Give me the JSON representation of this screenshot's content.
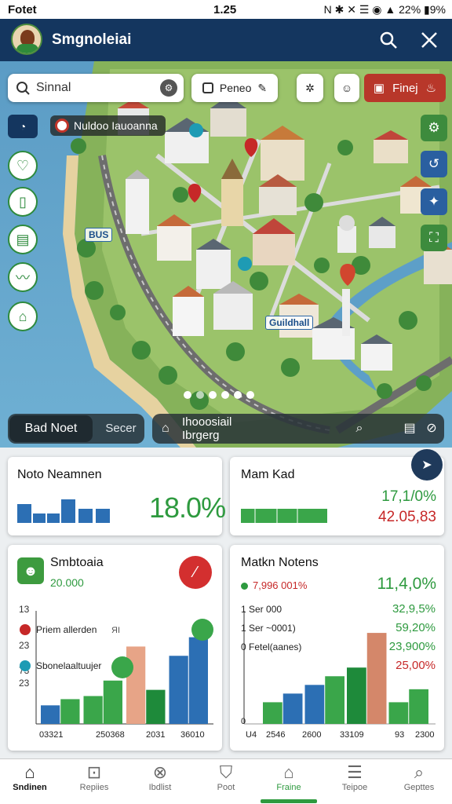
{
  "status_bar": {
    "left": "Fotet",
    "time": "1.25",
    "right": "N ✱ ✕ ☰ ◉ ▲ 22% ▮9%"
  },
  "header": {
    "title": "Smgnoleiai",
    "search_icon": "search-icon",
    "close_icon": "close-icon"
  },
  "map": {
    "search": {
      "placeholder": "Sinnal"
    },
    "filter_chip": "Peneo",
    "find_button": "Finej",
    "location_tag": "Nuldoo Iauoanna",
    "label_bus": "BUS",
    "label_building": "Guildhall",
    "carousel": {
      "count": 6,
      "active": 1
    }
  },
  "toolbar": {
    "seg_active": "Bad Noet",
    "seg_other": "Secer",
    "filter_text": "Ihooosiail Ibrgerg­"
  },
  "cards": {
    "card1": {
      "title": "Noto Neamnen",
      "value": "18.0%"
    },
    "card2": {
      "title": "Mam Kad",
      "value_green": "17,1/0%",
      "value_red": "42.05,83"
    },
    "card3": {
      "title": "Smbtoaia",
      "subtitle": "20.000",
      "y_ticks": [
        "13",
        "23",
        "73",
        "23"
      ],
      "legend": [
        "Priem allerden",
        "Sbonelaaltuujer"
      ],
      "legend_badge": "ЯI",
      "x_labels": [
        "0",
        "3321",
        "250368",
        "2031",
        "36010"
      ]
    },
    "card4": {
      "title": "Matkn Notens",
      "delta": "7,996 001%",
      "value": "11,4,0%",
      "rows": [
        "1 Ser 000",
        "1 Ser ~0001)",
        "0 Fetel(aanes)"
      ],
      "right_values": [
        "32,9,5%",
        "59,20%",
        "23,900%",
        "25,00%"
      ],
      "x_labels": [
        "U4",
        "2546",
        "2600",
        "33109",
        "93",
        "2300"
      ]
    }
  },
  "chart_data": [
    {
      "type": "bar",
      "title": "Smbtoaia",
      "categories": [
        "3321",
        "250368",
        "2031",
        "36010"
      ],
      "series": [
        {
          "name": "Priem allerden",
          "values": [
            6,
            9,
            25,
            22
          ]
        },
        {
          "name": "Sbonelaaltuujer",
          "values": [
            8,
            14,
            11,
            28
          ]
        }
      ],
      "ylim": [
        0,
        35
      ]
    },
    {
      "type": "bar",
      "title": "Matkn Notens",
      "categories": [
        "2546",
        "2600",
        "33109",
        "2300"
      ],
      "series": [
        {
          "name": "",
          "values": [
            5,
            9,
            13,
            5
          ]
        },
        {
          "name": "",
          "values": [
            7,
            11,
            21,
            8
          ]
        }
      ],
      "ylim": [
        0,
        25
      ]
    }
  ],
  "nav": [
    {
      "label": "Sndinen",
      "icon": "home-icon"
    },
    {
      "label": "Repiies",
      "icon": "inbox-icon"
    },
    {
      "label": "Ibdlist",
      "icon": "map-icon"
    },
    {
      "label": "Poot",
      "icon": "shield-icon"
    },
    {
      "label": "Fraine",
      "icon": "house-icon"
    },
    {
      "label": "Teipoe",
      "icon": "layers-icon"
    },
    {
      "label": "Gepttes",
      "icon": "search-icon"
    }
  ]
}
